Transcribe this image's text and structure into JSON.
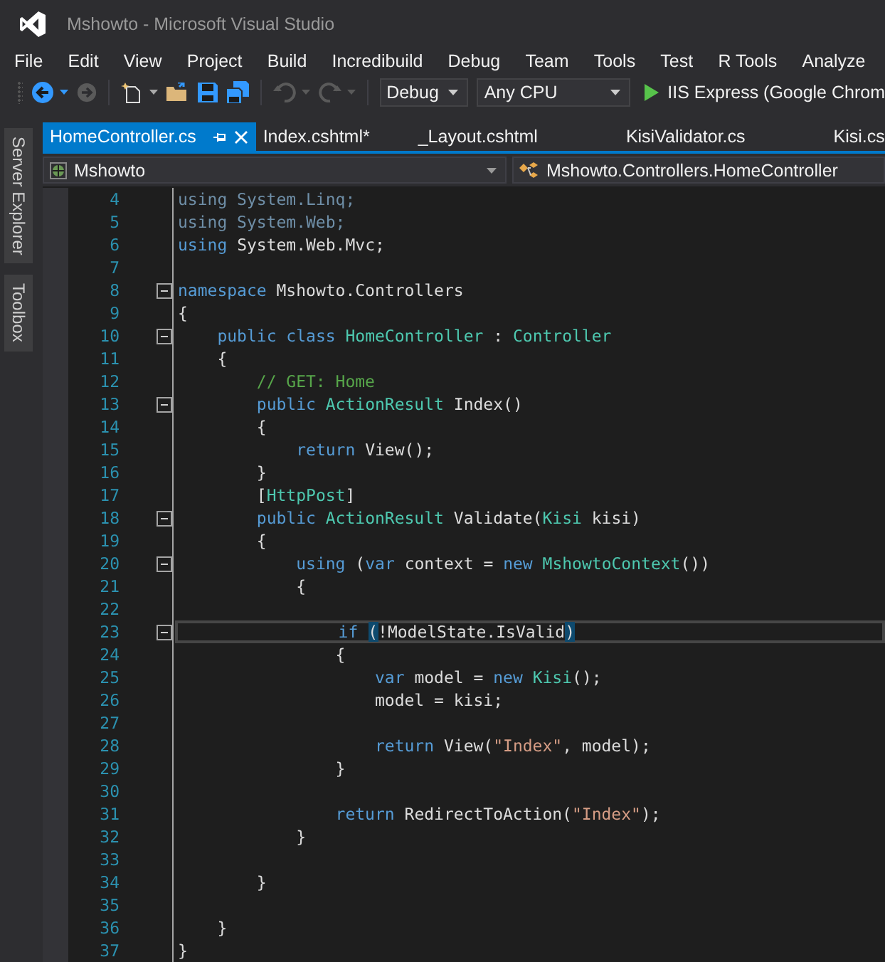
{
  "window": {
    "title": "Mshowto - Microsoft Visual Studio"
  },
  "menu": [
    "File",
    "Edit",
    "View",
    "Project",
    "Build",
    "Incredibuild",
    "Debug",
    "Team",
    "Tools",
    "Test",
    "R Tools",
    "Analyze"
  ],
  "toolbar": {
    "configuration": "Debug",
    "platform": "Any CPU",
    "run_target": "IIS Express (Google Chrom"
  },
  "side_tabs": [
    "Server Explorer",
    "Toolbox"
  ],
  "tabs": [
    {
      "label": "HomeController.cs",
      "selected": true
    },
    {
      "label": "Index.cshtml*",
      "selected": false
    },
    {
      "label": "_Layout.cshtml",
      "selected": false
    },
    {
      "label": "KisiValidator.cs",
      "selected": false
    },
    {
      "label": "Kisi.cs",
      "selected": false
    }
  ],
  "nav_bar": {
    "project": "Mshowto",
    "type": "Mshowto.Controllers.HomeController"
  },
  "code": [
    {
      "num": "4",
      "fold": false,
      "current": false,
      "tokens": [
        {
          "kind": "dim",
          "t": "using System.Linq;"
        }
      ]
    },
    {
      "num": "5",
      "fold": false,
      "current": false,
      "tokens": [
        {
          "kind": "dim",
          "t": "using System.Web;"
        }
      ]
    },
    {
      "num": "6",
      "fold": false,
      "current": false,
      "tokens": [
        {
          "kind": "kw",
          "t": "using"
        },
        {
          "kind": "plain",
          "t": " System.Web.Mvc;"
        }
      ]
    },
    {
      "num": "7",
      "fold": false,
      "current": false
    },
    {
      "num": "8",
      "fold": true,
      "current": false,
      "tokens": [
        {
          "kind": "kw",
          "t": "namespace"
        },
        {
          "kind": "plain",
          "t": " Mshowto.Controllers"
        }
      ]
    },
    {
      "num": "9",
      "fold": false,
      "current": false,
      "tokens": [
        {
          "kind": "plain",
          "t": "{"
        }
      ]
    },
    {
      "num": "10",
      "fold": true,
      "current": false,
      "tokens": [
        {
          "kind": "kw",
          "t": "    public class"
        },
        {
          "kind": "type",
          "t": " HomeController"
        },
        {
          "kind": "plain",
          "t": " : "
        },
        {
          "kind": "type",
          "t": "Controller"
        }
      ]
    },
    {
      "num": "11",
      "fold": false,
      "current": false,
      "tokens": [
        {
          "kind": "plain",
          "t": "    {"
        }
      ]
    },
    {
      "num": "12",
      "fold": false,
      "current": false,
      "tokens": [
        {
          "kind": "comment",
          "t": "        // GET: Home"
        }
      ]
    },
    {
      "num": "13",
      "fold": true,
      "current": false,
      "tokens": [
        {
          "kind": "kw",
          "t": "        public"
        },
        {
          "kind": "type",
          "t": " ActionResult"
        },
        {
          "kind": "plain",
          "t": " Index()"
        }
      ]
    },
    {
      "num": "14",
      "fold": false,
      "current": false,
      "tokens": [
        {
          "kind": "plain",
          "t": "        {"
        }
      ]
    },
    {
      "num": "15",
      "fold": false,
      "current": false,
      "tokens": [
        {
          "kind": "kw",
          "t": "            return"
        },
        {
          "kind": "plain",
          "t": " View();"
        }
      ]
    },
    {
      "num": "16",
      "fold": false,
      "current": false,
      "tokens": [
        {
          "kind": "plain",
          "t": "        }"
        }
      ]
    },
    {
      "num": "17",
      "fold": false,
      "current": false,
      "tokens": [
        {
          "kind": "plain",
          "t": "        ["
        },
        {
          "kind": "type",
          "t": "HttpPost"
        },
        {
          "kind": "plain",
          "t": "]"
        }
      ]
    },
    {
      "num": "18",
      "fold": true,
      "current": false,
      "tokens": [
        {
          "kind": "kw",
          "t": "        public"
        },
        {
          "kind": "type",
          "t": " ActionResult"
        },
        {
          "kind": "plain",
          "t": " Validate("
        },
        {
          "kind": "type",
          "t": "Kisi"
        },
        {
          "kind": "plain",
          "t": " kisi)"
        }
      ]
    },
    {
      "num": "19",
      "fold": false,
      "current": false,
      "tokens": [
        {
          "kind": "plain",
          "t": "        {"
        }
      ]
    },
    {
      "num": "20",
      "fold": true,
      "current": false,
      "tokens": [
        {
          "kind": "kw",
          "t": "            using"
        },
        {
          "kind": "plain",
          "t": " ("
        },
        {
          "kind": "kw",
          "t": "var"
        },
        {
          "kind": "plain",
          "t": " context = "
        },
        {
          "kind": "kw",
          "t": "new"
        },
        {
          "kind": "type",
          "t": " MshowtoContext"
        },
        {
          "kind": "plain",
          "t": "())"
        }
      ]
    },
    {
      "num": "21",
      "fold": false,
      "current": false,
      "tokens": [
        {
          "kind": "plain",
          "t": "            {"
        }
      ]
    },
    {
      "num": "22",
      "fold": false,
      "current": false
    },
    {
      "num": "23",
      "fold": true,
      "current": true,
      "tokens": [
        {
          "kind": "kw",
          "t": "                if"
        },
        {
          "kind": "match",
          "t": " ("
        },
        {
          "kind": "plain",
          "t": "!ModelState.IsValid"
        },
        {
          "kind": "match",
          "t": ")"
        }
      ]
    },
    {
      "num": "24",
      "fold": false,
      "current": false,
      "tokens": [
        {
          "kind": "plain",
          "t": "                {"
        }
      ]
    },
    {
      "num": "25",
      "fold": false,
      "current": false,
      "tokens": [
        {
          "kind": "kw",
          "t": "                    var"
        },
        {
          "kind": "plain",
          "t": " model = "
        },
        {
          "kind": "kw",
          "t": "new"
        },
        {
          "kind": "type",
          "t": " Kisi"
        },
        {
          "kind": "plain",
          "t": "();"
        }
      ]
    },
    {
      "num": "26",
      "fold": false,
      "current": false,
      "tokens": [
        {
          "kind": "plain",
          "t": "                    model = kisi;"
        }
      ]
    },
    {
      "num": "27",
      "fold": false,
      "current": false
    },
    {
      "num": "28",
      "fold": false,
      "current": false,
      "tokens": [
        {
          "kind": "kw",
          "t": "                    return"
        },
        {
          "kind": "plain",
          "t": " View("
        },
        {
          "kind": "str",
          "t": "\"Index\""
        },
        {
          "kind": "plain",
          "t": ", model);"
        }
      ]
    },
    {
      "num": "29",
      "fold": false,
      "current": false,
      "tokens": [
        {
          "kind": "plain",
          "t": "                }"
        }
      ]
    },
    {
      "num": "30",
      "fold": false,
      "current": false
    },
    {
      "num": "31",
      "fold": false,
      "current": false,
      "tokens": [
        {
          "kind": "kw",
          "t": "                return"
        },
        {
          "kind": "plain",
          "t": " RedirectToAction("
        },
        {
          "kind": "str",
          "t": "\"Index\""
        },
        {
          "kind": "plain",
          "t": ");"
        }
      ]
    },
    {
      "num": "32",
      "fold": false,
      "current": false,
      "tokens": [
        {
          "kind": "plain",
          "t": "            }"
        }
      ]
    },
    {
      "num": "33",
      "fold": false,
      "current": false
    },
    {
      "num": "34",
      "fold": false,
      "current": false,
      "tokens": [
        {
          "kind": "plain",
          "t": "        }"
        }
      ]
    },
    {
      "num": "35",
      "fold": false,
      "current": false
    },
    {
      "num": "36",
      "fold": false,
      "current": false,
      "tokens": [
        {
          "kind": "plain",
          "t": "    }"
        }
      ]
    },
    {
      "num": "37",
      "fold": false,
      "current": false,
      "tokens": [
        {
          "kind": "plain",
          "t": "}"
        }
      ]
    }
  ]
}
